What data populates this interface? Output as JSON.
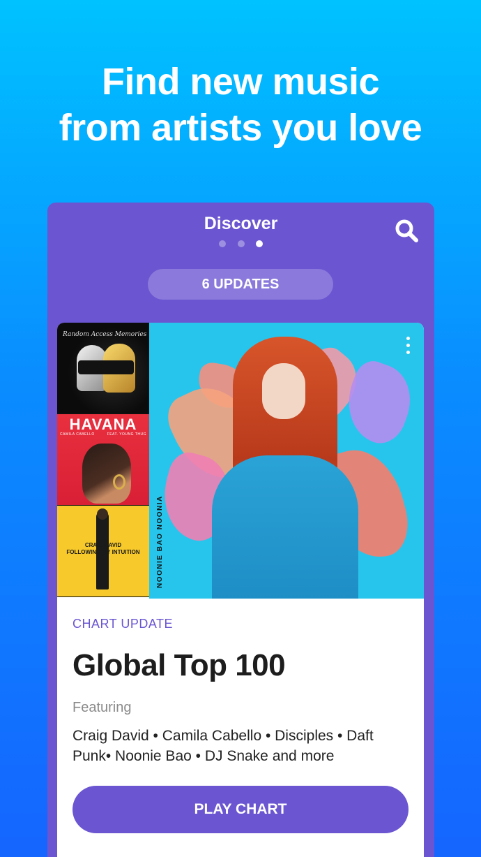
{
  "headline": {
    "line1": "Find new music",
    "line2": "from artists you love"
  },
  "app": {
    "title": "Discover",
    "pager": {
      "count": 3,
      "active_index": 2
    },
    "search_icon": "search-icon",
    "updates_label": "6 UPDATES"
  },
  "card": {
    "thumbnails": [
      {
        "name": "daft-punk-album",
        "text": "Random Access Memories"
      },
      {
        "name": "havana-single",
        "title": "HAVANA",
        "artist": "CAMILA CABELLO",
        "feat": "FEAT. YOUNG THUG"
      },
      {
        "name": "craig-david-single",
        "line1": "CRAIG DAVID",
        "line2": "FOLLOWING MY INTUITION"
      }
    ],
    "hero_side_text": "NOONIE BAO  NOONIA",
    "more_icon": "more-vertical-icon",
    "eyebrow": "CHART UPDATE",
    "title": "Global Top 100",
    "featuring_label": "Featuring",
    "artists": "Craig David • Camila Cabello • Disciples • Daft Punk• Noonie Bao • DJ Snake and more",
    "cta": "PLAY CHART"
  },
  "colors": {
    "accent": "#6b55d1",
    "background_top": "#00c2ff",
    "background_bottom": "#1565ff"
  }
}
